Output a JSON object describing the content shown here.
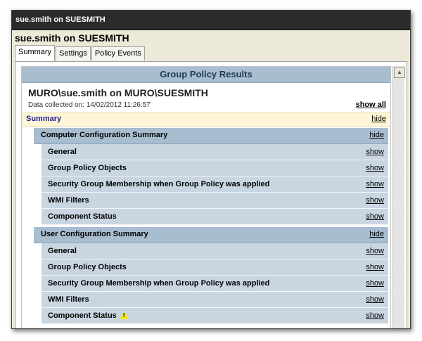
{
  "window": {
    "title": "sue.smith on SUESMITH"
  },
  "heading": "sue.smith on SUESMITH",
  "tabs": [
    {
      "label": "Summary",
      "active": true
    },
    {
      "label": "Settings",
      "active": false
    },
    {
      "label": "Policy Events",
      "active": false
    }
  ],
  "report": {
    "header": "Group Policy Results",
    "user_title": "MURO\\sue.smith on MURO\\SUESMITH",
    "collected": "Data collected on: 14/02/2012 11:26:57",
    "show_all": "show all",
    "summary": {
      "label": "Summary",
      "action": "hide"
    },
    "computer": {
      "title": "Computer Configuration Summary",
      "action": "hide",
      "rows": [
        {
          "label": "General",
          "action": "show"
        },
        {
          "label": "Group Policy Objects",
          "action": "show"
        },
        {
          "label": "Security Group Membership when Group Policy was applied",
          "action": "show"
        },
        {
          "label": "WMI Filters",
          "action": "show"
        },
        {
          "label": "Component Status",
          "action": "show"
        }
      ]
    },
    "user": {
      "title": "User Configuration Summary",
      "action": "hide",
      "rows": [
        {
          "label": "General",
          "action": "show"
        },
        {
          "label": "Group Policy Objects",
          "action": "show"
        },
        {
          "label": "Security Group Membership when Group Policy was applied",
          "action": "show"
        },
        {
          "label": "WMI Filters",
          "action": "show"
        },
        {
          "label": "Component Status",
          "action": "show",
          "warning": true,
          "warning_icon": "warning-icon"
        }
      ]
    }
  },
  "colors": {
    "header_blue": "#a9bdd0",
    "row_blue": "#c9d6e2",
    "summary_bar": "#fff6d6",
    "warning": "#f7e600"
  }
}
